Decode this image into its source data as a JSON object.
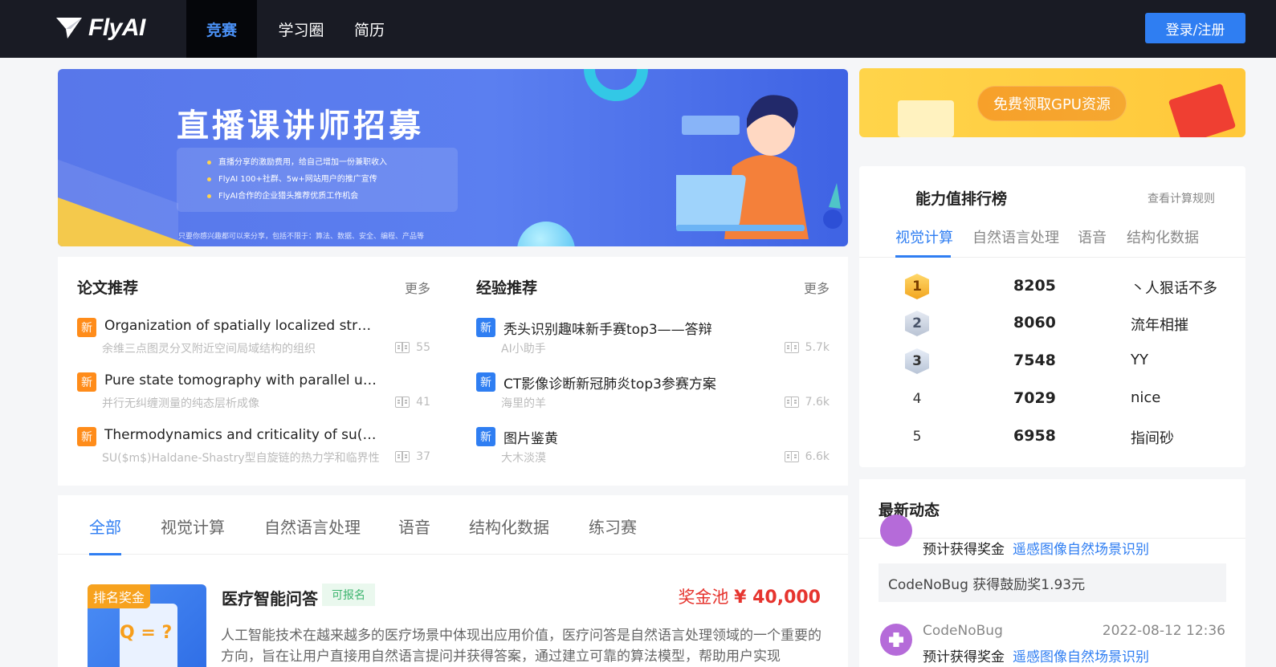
{
  "header": {
    "logo_text": "FlyAI",
    "nav": [
      "竞赛",
      "学习圈",
      "简历"
    ],
    "login_label": "登录/注册"
  },
  "banner": {
    "title": "直播课讲师招募",
    "points": [
      "直播分享的激励费用，给自己增加一份兼职收入",
      "FlyAI 100+社群、5w+网站用户的推广宣传",
      "FlyAI合作的企业猎头推荐优质工作机会"
    ],
    "footnote": "只要你感兴趣都可以来分享，包括不限于：算法、数据、安全、编程、产品等"
  },
  "gpu_banner": {
    "label": "免费领取GPU资源"
  },
  "papers": {
    "title": "论文推荐",
    "more": "更多",
    "tag": "新",
    "items": [
      {
        "title": "Organization of spatially localized structures near a continuum of ...",
        "subtitle": "余维三点图灵分叉附近空间局域结构的组织",
        "count": "55"
      },
      {
        "title": "Pure state tomography with parallel unentangled measurements",
        "subtitle": "并行无纠缠测量的纯态层析成像",
        "count": "41"
      },
      {
        "title": "Thermodynamics and criticality of su($m$) spin chains of Haldane-Shastry type",
        "subtitle": "SU($m$)Haldane-Shastry型自旋链的热力学和临界性",
        "count": "37"
      }
    ]
  },
  "experience": {
    "title": "经验推荐",
    "more": "更多",
    "tag": "新",
    "items": [
      {
        "title": "秃头识别趣味新手赛top3——答辩",
        "subtitle": "AI小助手",
        "count": "5.7k"
      },
      {
        "title": "CT影像诊断新冠肺炎top3参赛方案",
        "subtitle": "海里的羊",
        "count": "7.6k"
      },
      {
        "title": "图片鉴黄",
        "subtitle": "大木淡漠",
        "count": "6.6k"
      }
    ]
  },
  "ranking": {
    "title": "能力值排行榜",
    "rule_link": "查看计算规则",
    "tabs": [
      "视觉计算",
      "自然语言处理",
      "语音",
      "结构化数据"
    ],
    "rows": [
      {
        "pos": "1",
        "score": "8205",
        "user": "丶人狠话不多"
      },
      {
        "pos": "2",
        "score": "8060",
        "user": "流年相摧"
      },
      {
        "pos": "3",
        "score": "7548",
        "user": "YY"
      },
      {
        "pos": "4",
        "score": "7029",
        "user": "nice"
      },
      {
        "pos": "5",
        "score": "6958",
        "user": "指间砂"
      }
    ]
  },
  "categories": [
    "全部",
    "视觉计算",
    "自然语言处理",
    "语音",
    "结构化数据",
    "练习赛"
  ],
  "competition": {
    "badge": "排名奖金",
    "image_text": "Q = ?",
    "title": "医疗智能问答",
    "status": "可报名",
    "prize_label": "奖金池",
    "prize_value": "¥ 40,000",
    "description": "人工智能技术在越来越多的医疗场景中体现出应用价值，医疗问答是自然语言处理领域的一个重要的方向，旨在让用户直接用自然语言提问并获得答案，通过建立可靠的算法模型，帮助用户实现"
  },
  "news": {
    "title": "最新动态",
    "top_line_prefix": "预计获得奖金",
    "top_line_link": "遥感图像自然场景识别",
    "box_text": "CodeNoBug 获得鼓励奖1.93元",
    "user": "CodeNoBug",
    "time": "2022-08-12 12:36",
    "bottom_line_prefix": "预计获得奖金",
    "bottom_line_link": "遥感图像自然场景识别"
  },
  "colors": {
    "header_bg": "#191b24",
    "accent": "#2f7ef2",
    "prize": "#e6342e",
    "tag_orange": "#ff8c1a"
  }
}
